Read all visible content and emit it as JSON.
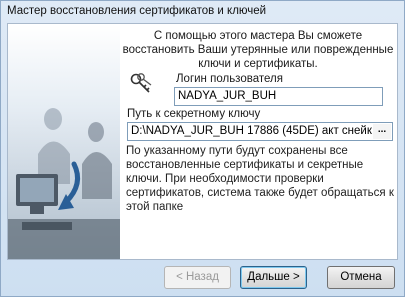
{
  "window": {
    "title": "Мастер восстановления сертификатов и ключей"
  },
  "intro_text": "С помощью этого мастера Вы сможете восстановить Ваши утерянные или поврежденные ключи и сертификаты.",
  "login": {
    "label": "Логин пользователя",
    "value": "NADYA_JUR_BUH"
  },
  "key_path": {
    "label": "Путь к секретному ключу",
    "value": "D:\\NADYA_JUR_BUH 17886 (45DE) акт снейк",
    "browse_label": "..."
  },
  "note_text": "По указанному пути будут сохранены все восстановленные сертификаты и секретные ключи. При необходимости проверки сертификатов, система также будет обращаться к этой папке",
  "buttons": {
    "back_label": "< Назад",
    "next_label": "Дальше >",
    "cancel_label": "Отмена"
  },
  "icons": {
    "wizard_art": "office-workers-art",
    "key": "keys-icon"
  }
}
